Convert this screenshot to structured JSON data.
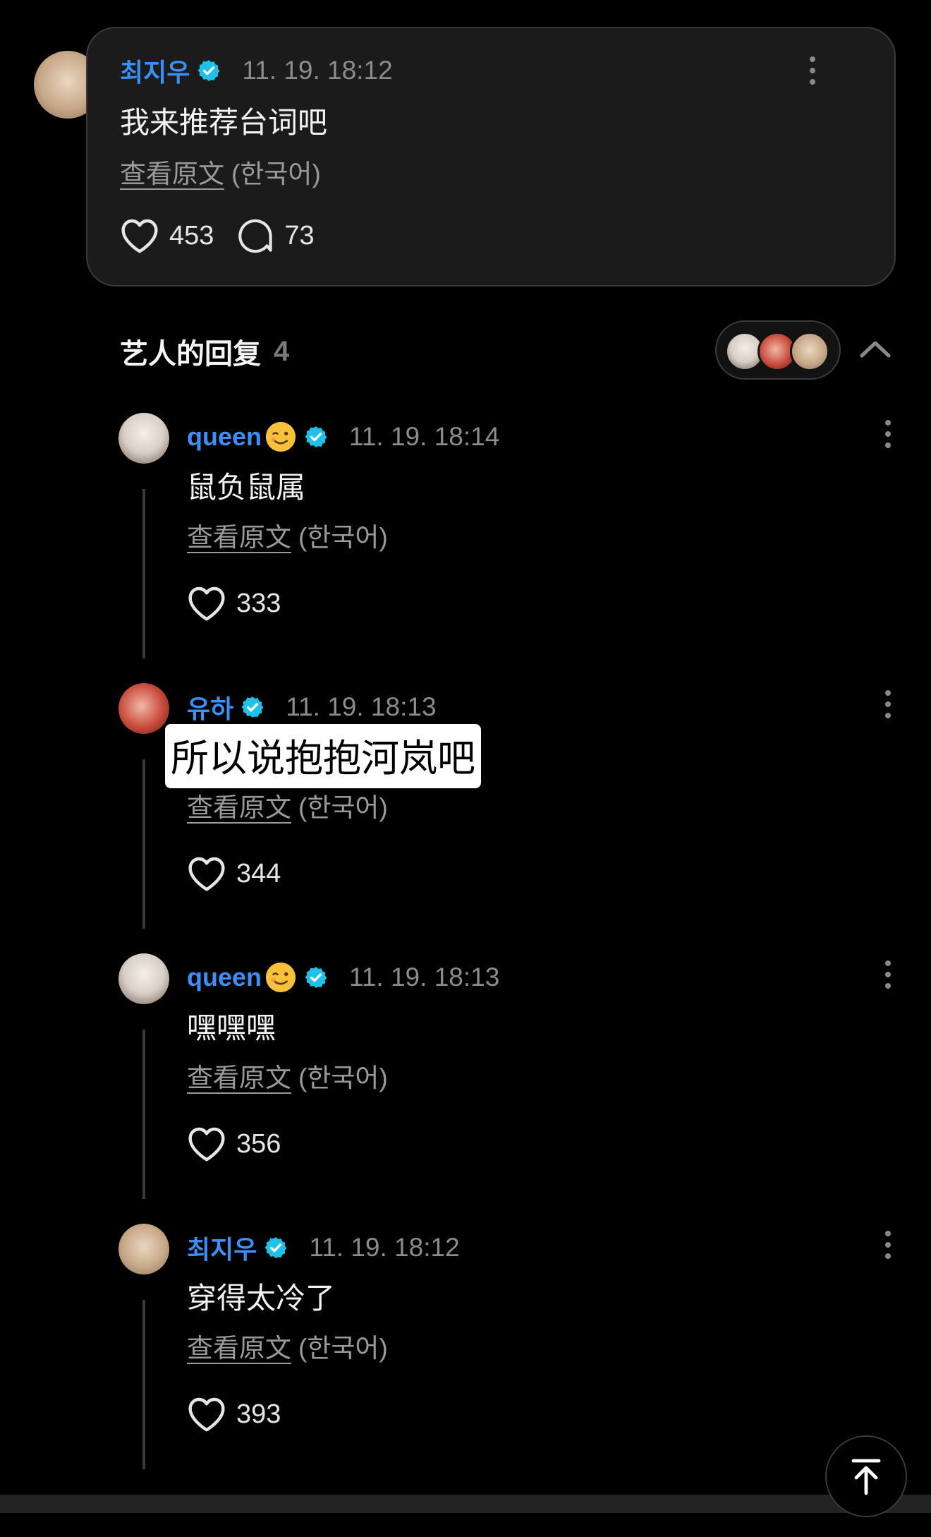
{
  "post": {
    "author": "최지우",
    "time": "11. 19. 18:12",
    "text": "我来推荐台词吧",
    "translate_link": "查看原文",
    "translate_lang": "(한국어)",
    "likes": "453",
    "comments": "73"
  },
  "artist_replies": {
    "title": "艺人的回复",
    "count": "4"
  },
  "replies": [
    {
      "author": "queen",
      "time": "11. 19. 18:14",
      "text": "鼠负鼠属",
      "translate_link": "查看原文",
      "translate_lang": "(한국어)",
      "likes": "333"
    },
    {
      "author": "유하",
      "time": "11. 19. 18:13",
      "text": "所以说抱抱河岚吧",
      "translate_link": "查看原文",
      "translate_lang": "(한국어)",
      "likes": "344"
    },
    {
      "author": "queen",
      "time": "11. 19. 18:13",
      "text": "嘿嘿嘿",
      "translate_link": "查看原文",
      "translate_lang": "(한국어)",
      "likes": "356"
    },
    {
      "author": "최지우",
      "time": "11. 19. 18:12",
      "text": "穿得太冷了",
      "translate_link": "查看原文",
      "translate_lang": "(한국어)",
      "likes": "393"
    }
  ],
  "colors": {
    "background": "#000000",
    "card": "#1b1b1b",
    "name_blue": "#3b8ff5",
    "verified_badge": "#1fc1e8"
  },
  "icons": [
    "verified-icon",
    "heart-icon",
    "comment-icon",
    "more-icon",
    "chevron-up-icon",
    "wink-emoji-icon",
    "arrow-up-to-top-icon"
  ]
}
